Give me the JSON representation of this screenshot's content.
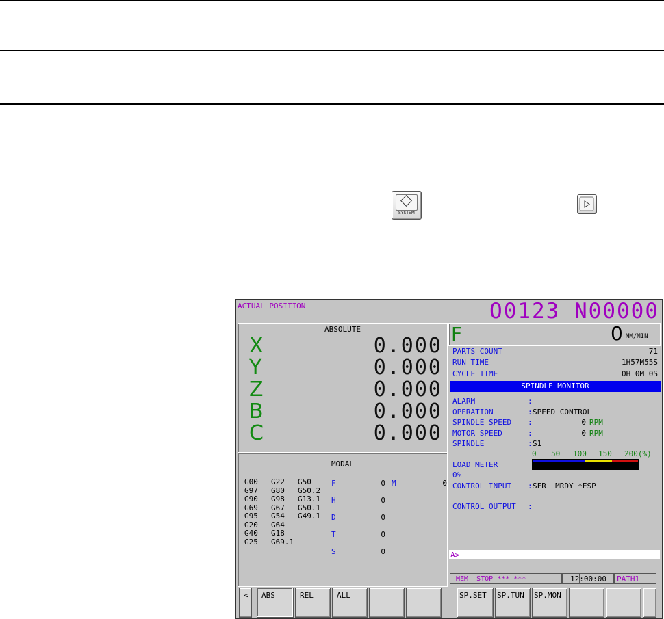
{
  "icons": {
    "system_key": "system-key-icon",
    "next_key": "next-page-key-icon"
  },
  "colors": {
    "accent_magenta": "#a000c0",
    "label_blue": "#1010e0",
    "value_green": "#108010",
    "title_bar_blue": "#0000ee"
  },
  "header": {
    "title": "ACTUAL POSITION",
    "program": "O0123 N00000"
  },
  "absolute": {
    "title": "ABSOLUTE",
    "axes": [
      {
        "name": "X",
        "value": "0.000"
      },
      {
        "name": "Y",
        "value": "0.000"
      },
      {
        "name": "Z",
        "value": "0.000"
      },
      {
        "name": "B",
        "value": "0.000"
      },
      {
        "name": "C",
        "value": "0.000"
      }
    ]
  },
  "feed": {
    "label": "F",
    "value": "0",
    "unit": "MM/MIN"
  },
  "counters": [
    {
      "label": "PARTS COUNT",
      "value": "71"
    },
    {
      "label": "RUN TIME",
      "value": "1H57M55S"
    },
    {
      "label": "CYCLE TIME",
      "value": "0H 0M 0S"
    }
  ],
  "spindle_monitor": {
    "title": "SPINDLE MONITOR",
    "alarm_label": "ALARM",
    "alarm_value": "",
    "operation_label": "OPERATION",
    "operation_value": "SPEED CONTROL",
    "spindle_speed_label": "SPINDLE SPEED",
    "spindle_speed_value": "0",
    "spindle_speed_unit": "RPM",
    "motor_speed_label": "MOTOR SPEED",
    "motor_speed_value": "0",
    "motor_speed_unit": "RPM",
    "spindle_label": "SPINDLE",
    "spindle_value": "S1",
    "load_meter_label": "LOAD METER",
    "load_meter_value": "0%",
    "load_percent": 0,
    "load_scale": [
      "0",
      "50",
      "100",
      "150",
      "200(%)"
    ],
    "control_input_label": "CONTROL INPUT",
    "control_input_value": "SFR  MRDY *ESP",
    "control_output_label": "CONTROL OUTPUT",
    "control_output_value": ""
  },
  "modal": {
    "title": "MODAL",
    "g_rows": [
      [
        "G00",
        "G22",
        "G50"
      ],
      [
        "G97",
        "G80",
        "G50.2"
      ],
      [
        "G90",
        "G98",
        "G13.1"
      ],
      [
        "G69",
        "G67",
        "G50.1"
      ],
      [
        "G95",
        "G54",
        "G49.1"
      ],
      [
        "G20",
        "G64",
        ""
      ],
      [
        "G40",
        "G18",
        ""
      ],
      [
        "G25",
        "G69.1",
        ""
      ]
    ],
    "F": "0",
    "M": "0",
    "H": "0",
    "D": "0",
    "T": "0",
    "S": "0"
  },
  "input_prompt": "A>",
  "status": {
    "mode": "MEM  STOP *** ***",
    "time": "12:00:00",
    "path": "PATH1"
  },
  "softkeys": [
    "<",
    "ABS",
    "REL",
    "ALL",
    "",
    "",
    "SP.SET",
    "SP.TUN",
    "SP.MON",
    "",
    "",
    ""
  ]
}
